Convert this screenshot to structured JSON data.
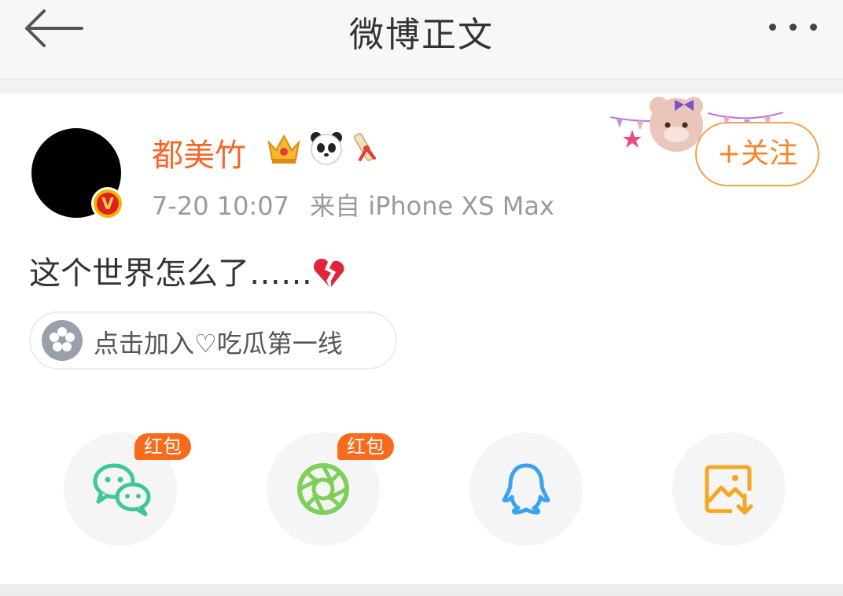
{
  "header": {
    "title": "微博正文",
    "back_icon": "arrow-left-icon",
    "more_icon": "more-dots-icon"
  },
  "post": {
    "author": "都美竹",
    "verified_badge": "V",
    "badge_icons": [
      "crown-icon",
      "panda-icon",
      "ribbon-scroll-icon"
    ],
    "time": "7-20 10:07",
    "source": "来自 iPhone XS Max",
    "follow_label": "+关注",
    "text": "这个世界怎么了……",
    "text_emoji": "broken-heart-icon",
    "topic_label": "点击加入♡吃瓜第一线"
  },
  "share": {
    "items": [
      {
        "name": "wechat",
        "icon": "wechat-icon",
        "badge": "红包"
      },
      {
        "name": "moments",
        "icon": "moments-icon",
        "badge": "红包"
      },
      {
        "name": "qq",
        "icon": "qq-icon",
        "badge": ""
      },
      {
        "name": "save-image",
        "icon": "save-image-icon",
        "badge": ""
      }
    ]
  },
  "colors": {
    "accent": "#f7862b",
    "username": "#f7672b",
    "redpacket": "#f86b1d",
    "wechat": "#3fc79a",
    "moments": "#7ed05a",
    "qq": "#3aa3f0",
    "save": "#f5a623"
  }
}
